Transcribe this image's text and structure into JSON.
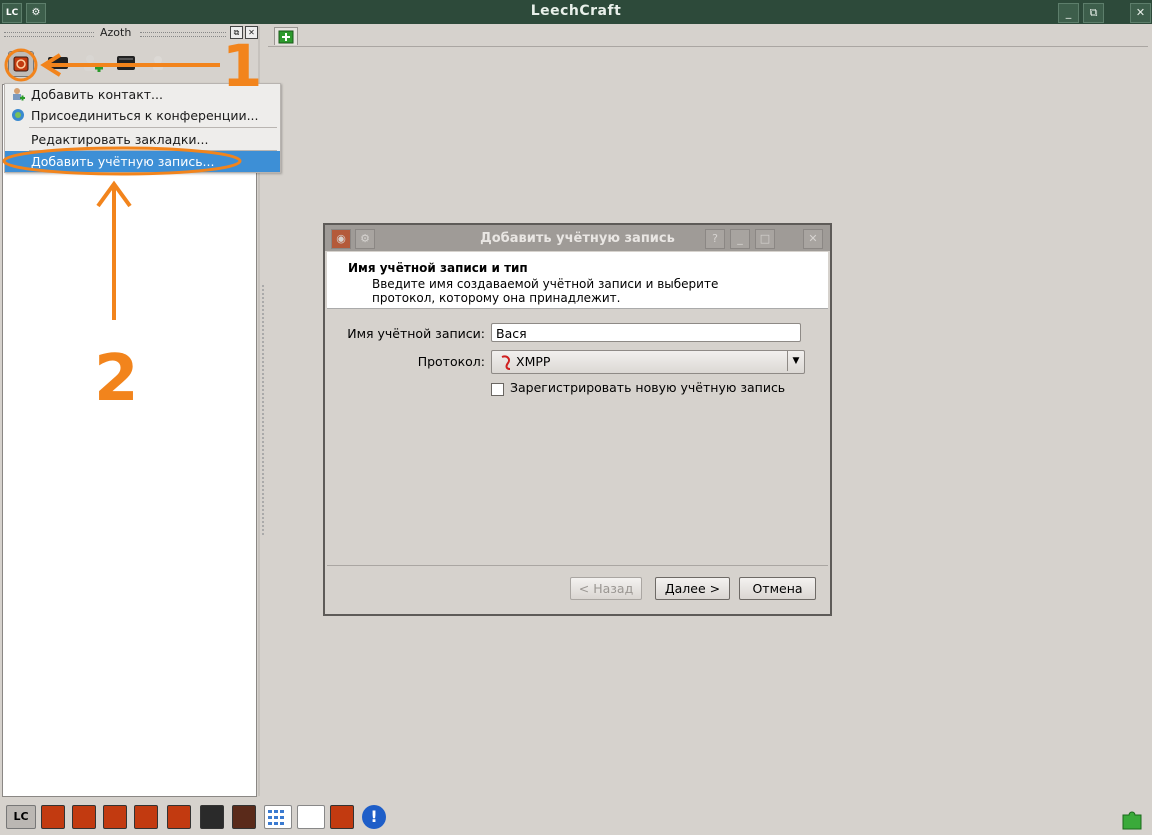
{
  "window": {
    "title": "LeechCraft"
  },
  "dock": {
    "title": "Azoth"
  },
  "menu": {
    "items": [
      {
        "label": "Добавить контакт..."
      },
      {
        "label": "Присоединиться к конференции..."
      },
      {
        "label": "Редактировать закладки..."
      },
      {
        "label": "Добавить учётную запись..."
      }
    ]
  },
  "dialog": {
    "title": "Добавить учётную запись",
    "header_title": "Имя учётной записи и тип",
    "header_desc": "Введите имя создаваемой учётной записи и выберите протокол, которому она принадлежит.",
    "account_label": "Имя учётной записи:",
    "account_value": "Вася",
    "protocol_label": "Протокол:",
    "protocol_value": "XMPP",
    "register_label": "Зарегистрировать новую учётную запись",
    "back_label": "< Назад",
    "next_label": "Далее >",
    "cancel_label": "Отмена"
  },
  "annotations": {
    "step1": "1",
    "step2": "2"
  },
  "colors": {
    "titlebar": "#2d4a3a",
    "accent": "#3d8fd6",
    "annotation": "#f2841c"
  }
}
